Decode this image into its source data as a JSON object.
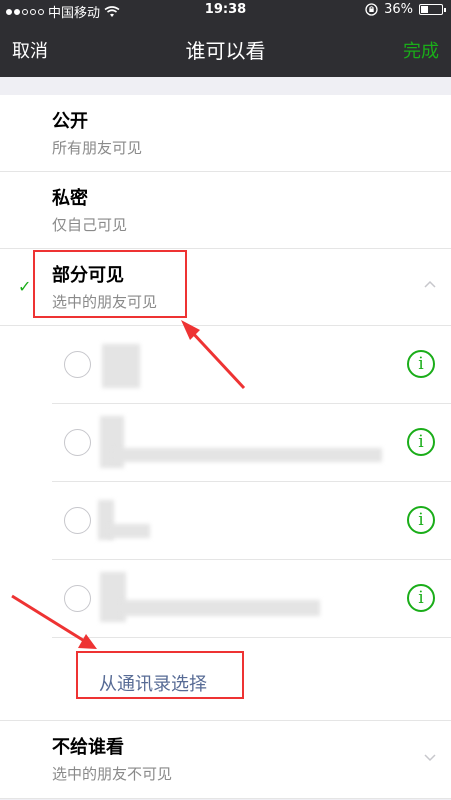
{
  "status": {
    "carrier": "中国移动",
    "time": "19:38",
    "battery_percent": "36%",
    "battery_level": 0.36,
    "signal_icons": [
      "signal-dot-icon",
      "signal-dot-icon",
      "signal-dot-icon",
      "signal-dot-icon",
      "signal-dot-icon"
    ],
    "wifi_icon": "wifi-icon",
    "lock_icon": "rotation-lock-icon"
  },
  "nav": {
    "cancel": "取消",
    "title": "谁可以看",
    "done": "完成"
  },
  "options": [
    {
      "title": "公开",
      "sub": "所有朋友可见"
    },
    {
      "title": "私密",
      "sub": "仅自己可见"
    },
    {
      "title": "部分可见",
      "sub": "选中的朋友可见",
      "selected": true,
      "chevron": "chevron-up-icon"
    },
    {
      "title": "不给谁看",
      "sub": "选中的朋友不可见",
      "chevron": "chevron-down-icon"
    }
  ],
  "friends": [
    {
      "name": "",
      "checked": false
    },
    {
      "name": "",
      "checked": false
    },
    {
      "name": "",
      "checked": false
    },
    {
      "name": "",
      "checked": false
    }
  ],
  "contact_select": "从通讯录选择",
  "colors": {
    "accent": "#1aad19",
    "link": "#576b95",
    "annotation": "#e33333",
    "nav_bg": "#2e2e32"
  }
}
